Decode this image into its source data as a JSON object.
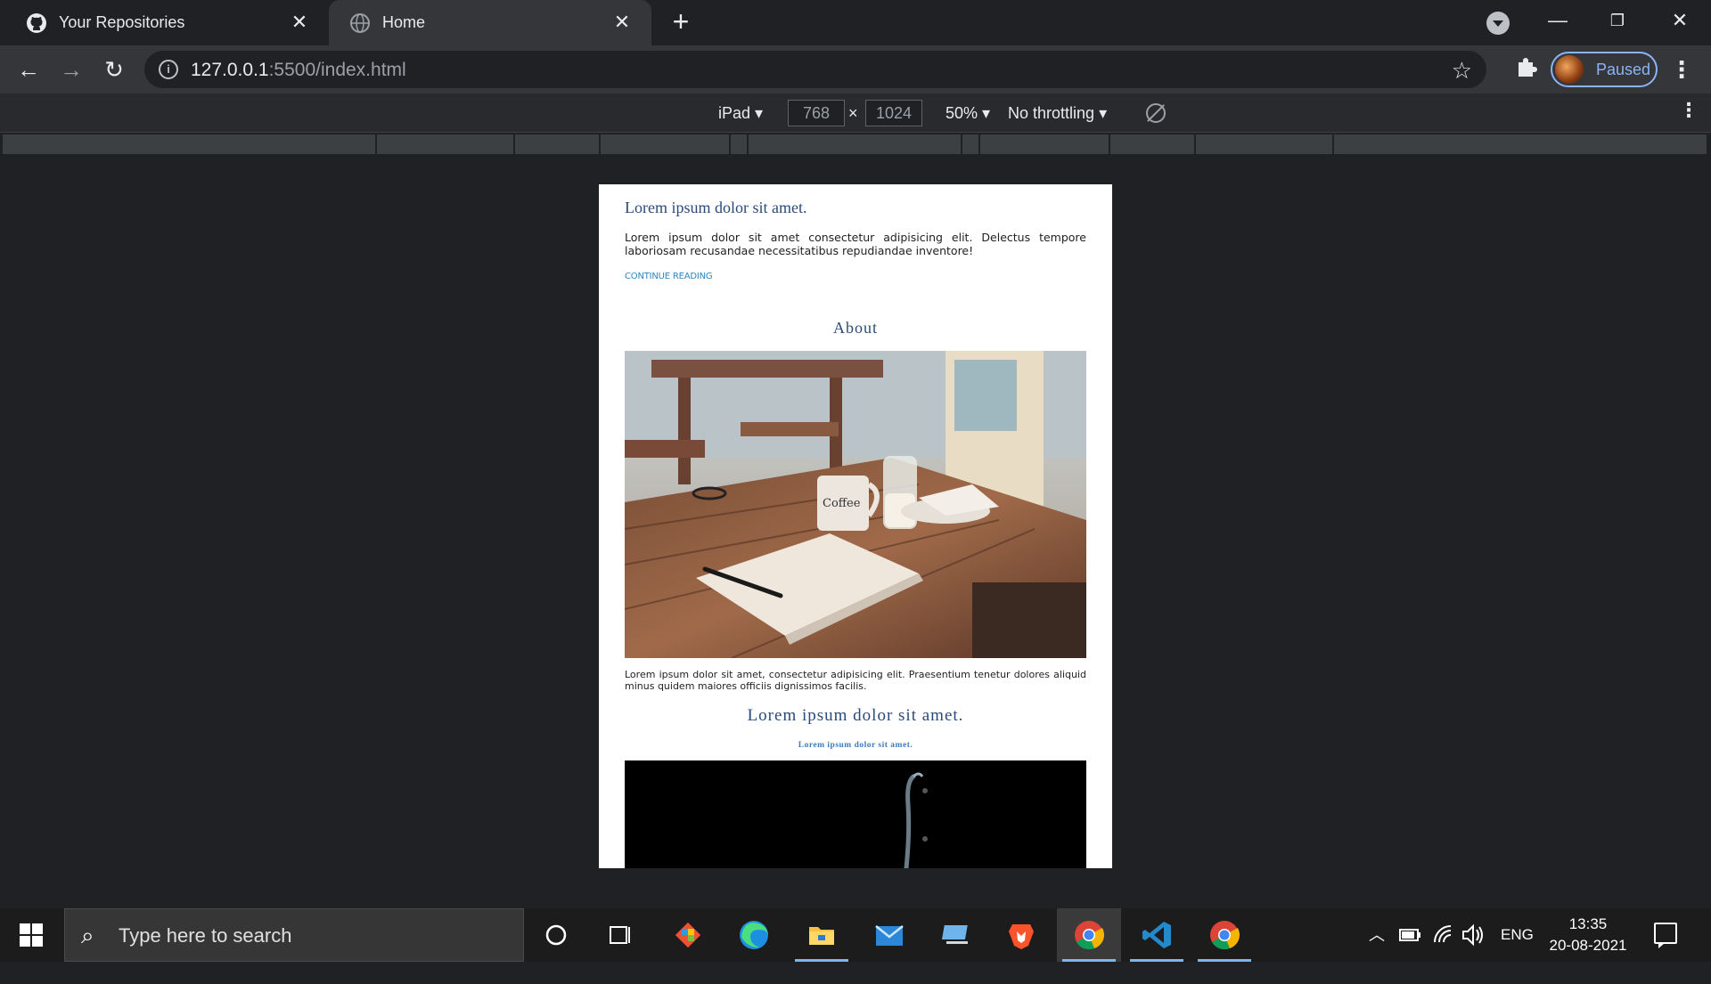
{
  "browser": {
    "tabs": [
      {
        "title": "Your Repositories",
        "icon": "github-icon",
        "active": false
      },
      {
        "title": "Home",
        "icon": "globe-icon",
        "active": true
      }
    ],
    "address": {
      "host": "127.0.0.1",
      "rest": ":5500/index.html"
    },
    "profile_status": "Paused"
  },
  "device_toolbar": {
    "device": "iPad",
    "width": "768",
    "times": "×",
    "height": "1024",
    "zoom": "50%",
    "throttling": "No throttling"
  },
  "page": {
    "post_title": "Lorem ipsum dolor sit amet.",
    "post_body": "Lorem ipsum dolor sit amet consectetur adipisicing elit. Delectus tempore laboriosam recusandae necessitatibus repudiandae inventore!",
    "continue_link": "CONTINUE READING",
    "about_heading": "About",
    "about_body": "Lorem ipsum dolor sit amet, consectetur adipisicing elit. Praesentium tenetur dolores aliquid minus quidem maiores officiis dignissimos facilis.",
    "third_heading": "Lorem ipsum dolor sit amet.",
    "third_sub": "Lorem ipsum dolor sit amet.",
    "photo_mug_text": "Coffee"
  },
  "taskbar": {
    "search_placeholder": "Type here to search",
    "language": "ENG",
    "time": "13:35",
    "date": "20-08-2021",
    "accent": "#76b9ed"
  }
}
